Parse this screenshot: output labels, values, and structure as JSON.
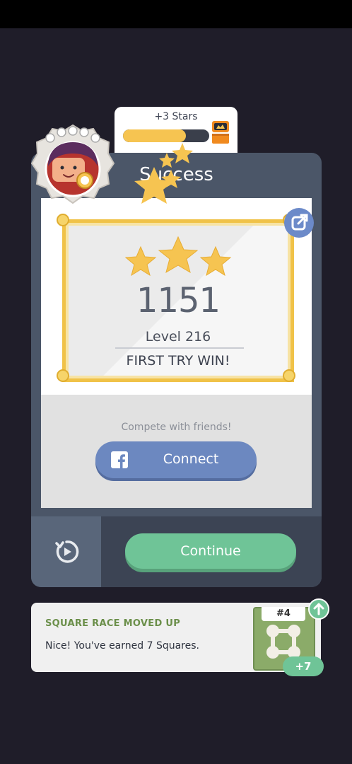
{
  "stars_tab": {
    "label": "+3 Stars",
    "progress_fraction": 0.73
  },
  "card": {
    "title": "Success",
    "score": "1151",
    "level": "Level 216",
    "result": "FIRST TRY WIN!",
    "stars_earned": 3
  },
  "friends": {
    "prompt": "Compete with friends!",
    "connect_label": "Connect"
  },
  "actions": {
    "continue_label": "Continue"
  },
  "notification": {
    "title": "SQUARE RACE MOVED UP",
    "text": "Nice! You've earned 7 Squares.",
    "rank": "#4",
    "reward": "+7"
  },
  "colors": {
    "background": "#1f1d29",
    "card": "#4b5668",
    "star_gold": "#f6c451",
    "continue_green": "#6fc497",
    "facebook_blue": "#6c88c0",
    "notif_title_green": "#6b8f4a"
  },
  "icons": [
    "chest-icon",
    "share-icon",
    "facebook-icon",
    "replay-icon",
    "up-arrow-icon",
    "star-icon"
  ]
}
